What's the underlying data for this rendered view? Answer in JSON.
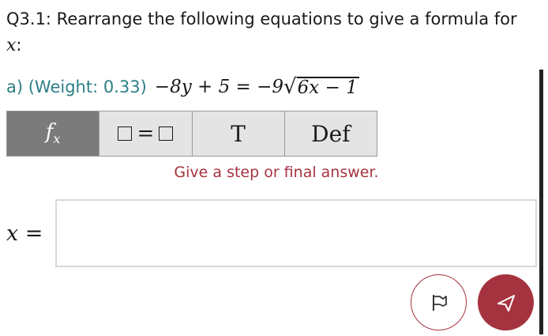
{
  "question": {
    "prefix": "Q3.1: Rearrange the following equations to give a formula for",
    "variable": "x",
    "suffix": ":"
  },
  "part": {
    "label": "a) (Weight: 0.33)",
    "equation": {
      "lhs": "−8y + 5 = −9",
      "radicand": "6x − 1"
    }
  },
  "toolbar": {
    "func_label": "f",
    "func_sub": "x",
    "eq_sign": "=",
    "t_label": "T",
    "def_label": "Def"
  },
  "hint": "Give a step or final answer.",
  "answer": {
    "label": "x =",
    "value": ""
  },
  "colors": {
    "accent": "#a5333f",
    "label_teal": "#2e7f86",
    "func_bg": "#7b7b7b",
    "tool_bg": "#e4e4e4"
  },
  "icons": {
    "flag": "flag-icon",
    "send": "send-icon"
  }
}
